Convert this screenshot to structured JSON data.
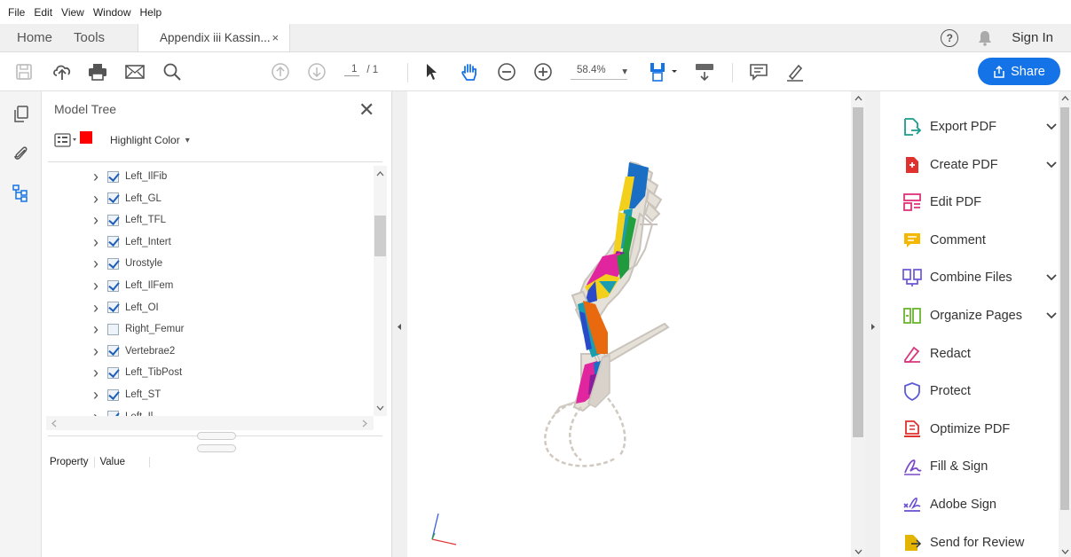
{
  "menu": {
    "file": "File",
    "edit": "Edit",
    "view": "View",
    "window": "Window",
    "help": "Help"
  },
  "tabs": {
    "home": "Home",
    "tools": "Tools",
    "document": "Appendix iii Kassin...",
    "close": "×"
  },
  "header": {
    "help": "?",
    "sign_in": "Sign In"
  },
  "toolbar": {
    "page_current": "1",
    "page_total": "/ 1",
    "zoom": "58.4%",
    "zoom_caret": "▾",
    "share_label": "Share"
  },
  "model_tree": {
    "title": "Model Tree",
    "close": "✕",
    "highlight_label": "Highlight Color",
    "highlight_caret": "▾",
    "highlight_color": "#ff0000",
    "items": [
      {
        "label": "Left_IlFib",
        "checked": true
      },
      {
        "label": "Left_GL",
        "checked": true
      },
      {
        "label": "Left_TFL",
        "checked": true
      },
      {
        "label": "Left_Intert",
        "checked": true
      },
      {
        "label": "Urostyle",
        "checked": true
      },
      {
        "label": "Left_IlFem",
        "checked": true
      },
      {
        "label": "Left_OI",
        "checked": true
      },
      {
        "label": "Right_Femur",
        "checked": false
      },
      {
        "label": "Vertebrae2",
        "checked": true
      },
      {
        "label": "Left_TibPost",
        "checked": true
      },
      {
        "label": "Left_ST",
        "checked": true
      },
      {
        "label": "Left_Il",
        "checked": true
      }
    ],
    "property_col": "Property",
    "value_col": "Value"
  },
  "tools_pane": {
    "items": [
      {
        "label": "Export PDF",
        "icon": "export-pdf-icon",
        "color": "#1a9d8f",
        "dropdown": true
      },
      {
        "label": "Create PDF",
        "icon": "create-pdf-icon",
        "color": "#e0312f",
        "dropdown": true
      },
      {
        "label": "Edit PDF",
        "icon": "edit-pdf-icon",
        "color": "#e0317a",
        "dropdown": false
      },
      {
        "label": "Comment",
        "icon": "comment-icon",
        "color": "#f5b800",
        "dropdown": false
      },
      {
        "label": "Combine Files",
        "icon": "combine-files-icon",
        "color": "#6a56d8",
        "dropdown": true
      },
      {
        "label": "Organize Pages",
        "icon": "organize-pages-icon",
        "color": "#6ab42d",
        "dropdown": true
      },
      {
        "label": "Redact",
        "icon": "redact-icon",
        "color": "#d9367e",
        "dropdown": false
      },
      {
        "label": "Protect",
        "icon": "protect-icon",
        "color": "#5b5bd6",
        "dropdown": false
      },
      {
        "label": "Optimize PDF",
        "icon": "optimize-pdf-icon",
        "color": "#e0312f",
        "dropdown": false
      },
      {
        "label": "Fill & Sign",
        "icon": "fill-sign-icon",
        "color": "#7b4cc9",
        "dropdown": false
      },
      {
        "label": "Adobe Sign",
        "icon": "adobe-sign-icon",
        "color": "#6a4bd3",
        "dropdown": false
      },
      {
        "label": "Send for Review",
        "icon": "send-for-review-icon",
        "color": "#e3b400",
        "dropdown": false
      }
    ]
  },
  "colors": {
    "accent": "#1473e6"
  }
}
